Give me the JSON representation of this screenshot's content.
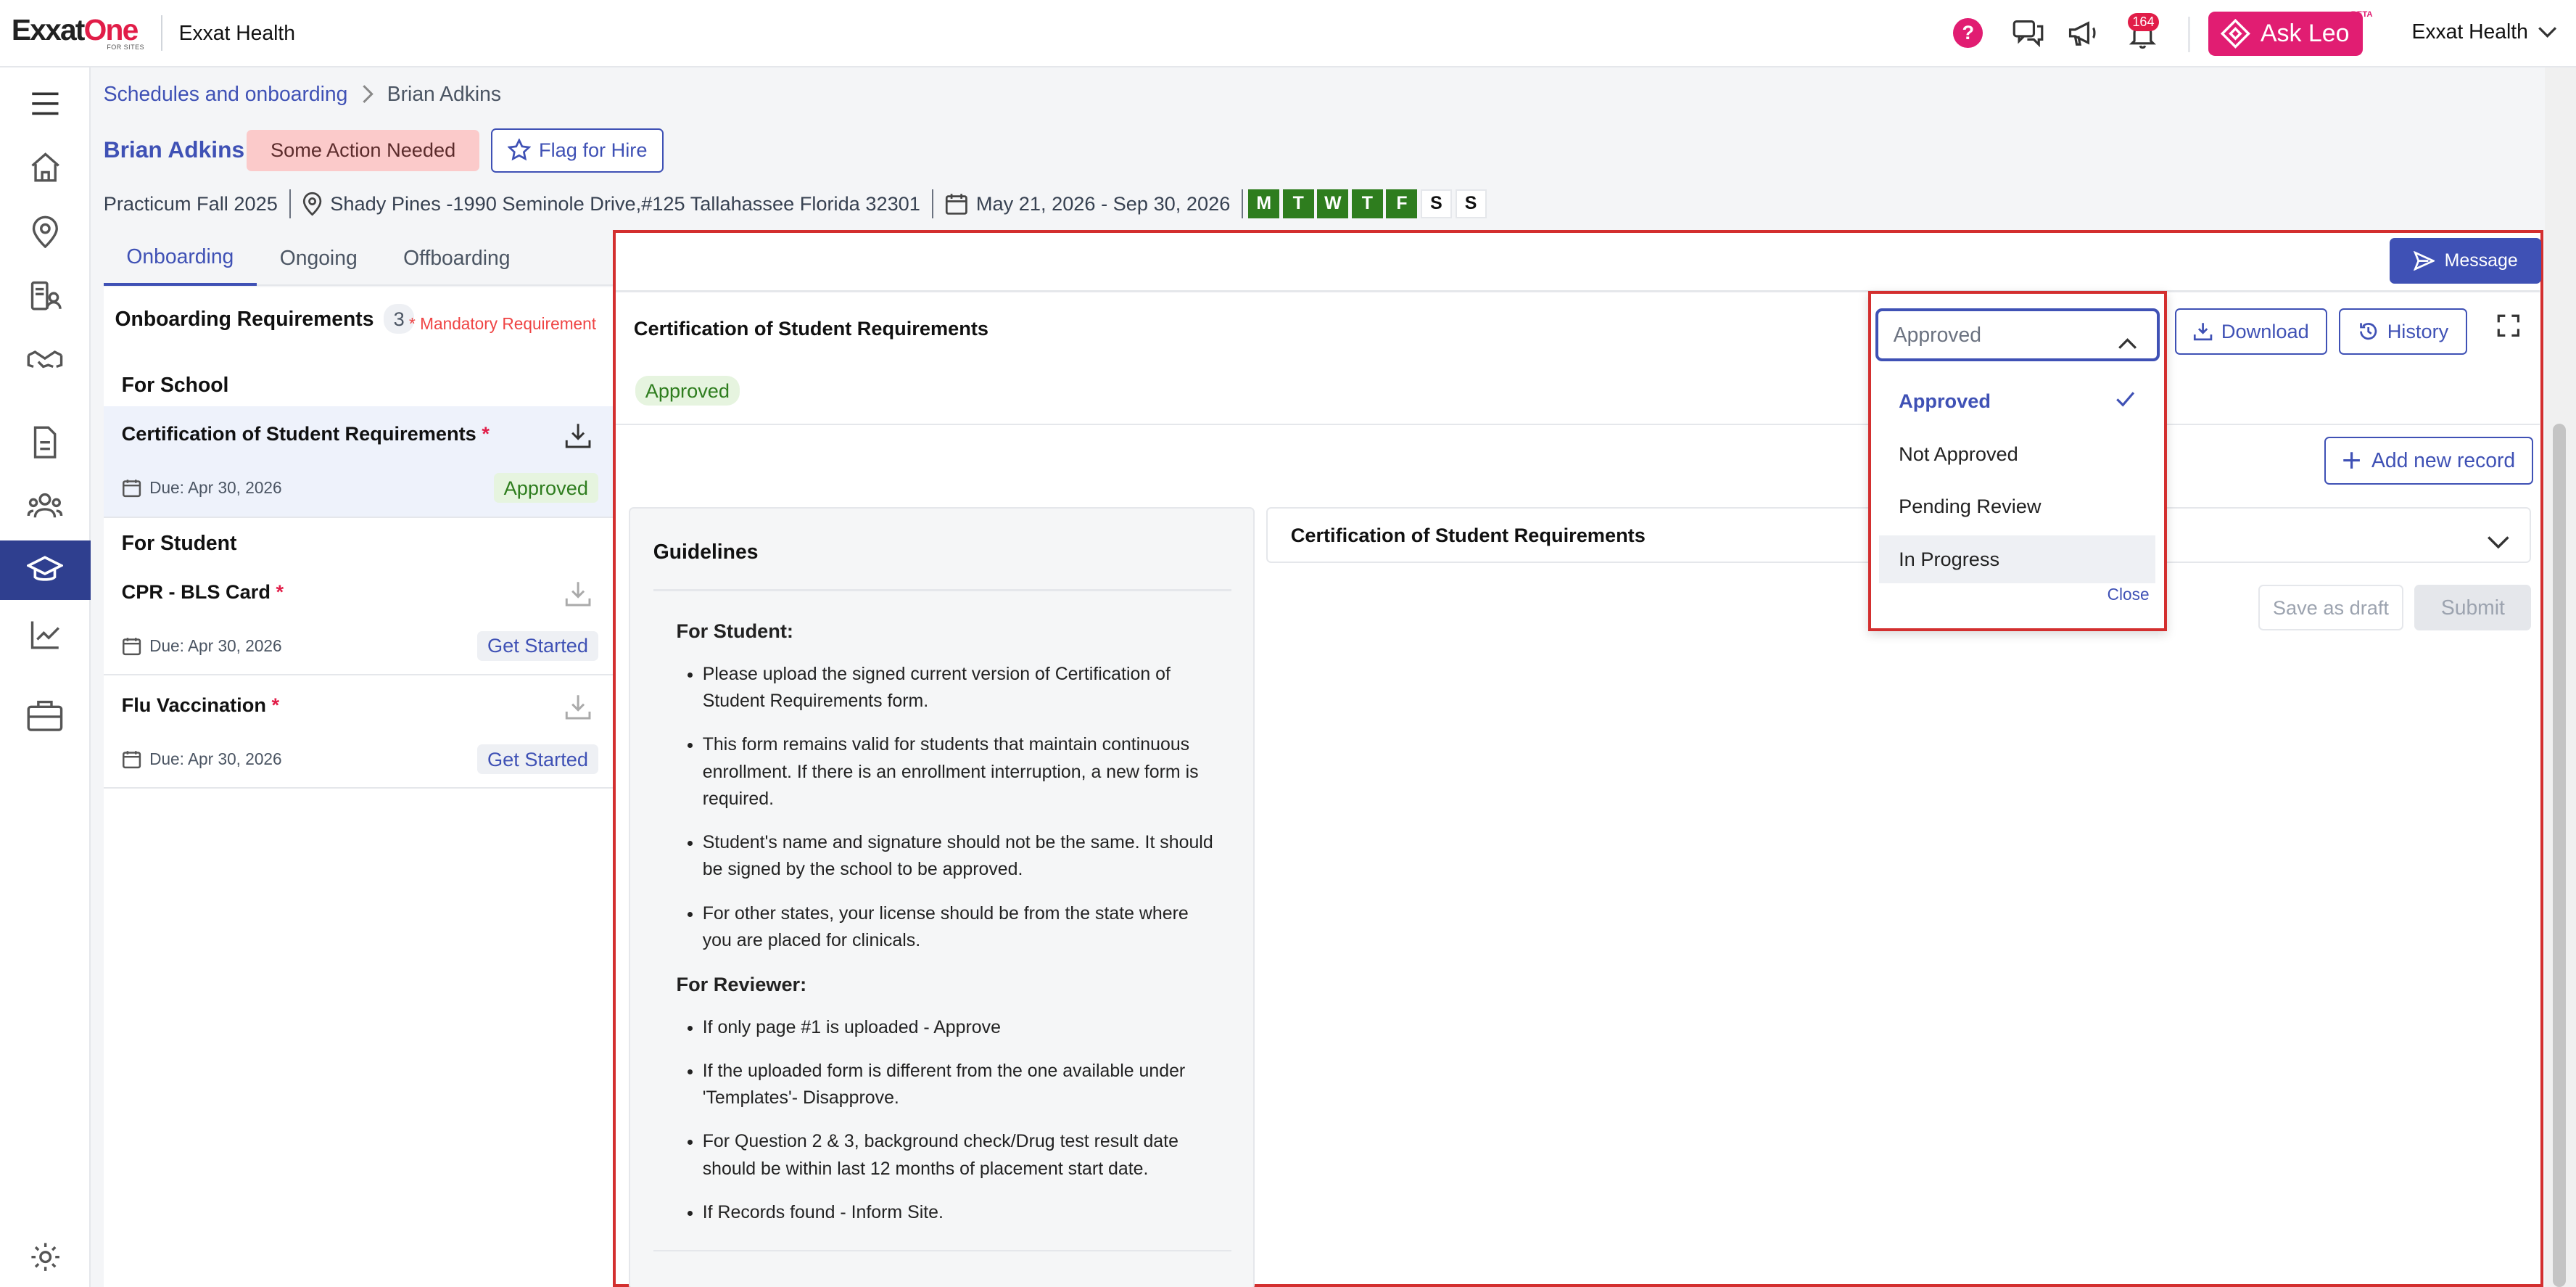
{
  "header": {
    "logo_main": "Exxat",
    "logo_one": "One",
    "logo_sub": "FOR SITES",
    "org_name": "Exxat Health",
    "help": "?",
    "notification_count": "164",
    "ask_leo": "Ask Leo",
    "beta": "BETA",
    "user_menu": "Exxat Health"
  },
  "breadcrumb": {
    "parent": "Schedules and onboarding",
    "current": "Brian Adkins"
  },
  "student": {
    "name": "Brian Adkins",
    "status_badge": "Some Action Needed",
    "flag_label": "Flag for Hire",
    "term": "Practicum Fall 2025",
    "site": "Shady Pines -1990 Seminole Drive,#125 Tallahassee Florida 32301",
    "dates": "May 21, 2026 - Sep 30, 2026",
    "days": [
      {
        "label": "M",
        "on": true
      },
      {
        "label": "T",
        "on": true
      },
      {
        "label": "W",
        "on": true
      },
      {
        "label": "T",
        "on": true
      },
      {
        "label": "F",
        "on": true
      },
      {
        "label": "S",
        "on": false
      },
      {
        "label": "S",
        "on": false
      }
    ]
  },
  "tabs": [
    "Onboarding",
    "Ongoing",
    "Offboarding"
  ],
  "requirements": {
    "heading": "Onboarding Requirements",
    "count": "3",
    "mandatory_note": "* Mandatory Requirement",
    "group_school": "For School",
    "group_student": "For Student",
    "items": [
      {
        "name": "Certification of Student Requirements",
        "star": "*",
        "due": "Due: Apr 30, 2026",
        "status": "Approved"
      },
      {
        "name": "CPR - BLS Card",
        "star": "*",
        "due": "Due: Apr 30, 2026",
        "status": "Get Started"
      },
      {
        "name": "Flu Vaccination",
        "star": "*",
        "due": "Due: Apr 30, 2026",
        "status": "Get Started"
      }
    ]
  },
  "detail": {
    "message_label": "Message",
    "title": "Certification of Student Requirements",
    "status": "Approved",
    "download_label": "Download",
    "history_label": "History",
    "add_record_label": "Add new record",
    "accordion_title": "Certification of Student Requirements",
    "save_draft_label": "Save as draft",
    "submit_label": "Submit"
  },
  "guidelines": {
    "title": "Guidelines",
    "student_heading": "For Student:",
    "student_items": [
      "Please upload the signed current version of Certification of Student Requirements form.",
      "This form remains valid for students that maintain continuous enrollment. If there is an enrollment interruption, a new form is required.",
      "Student's name and signature should not be the same. It should be signed by the school to be approved.",
      "For other states, your license should be from the state where you are placed for clinicals."
    ],
    "reviewer_heading": "For Reviewer:",
    "reviewer_items": [
      "If only page #1 is uploaded - Approve",
      "If the uploaded form is different from the one available under 'Templates'- Disapprove.",
      "For Question 2 & 3, background check/Drug test result date should be within last 12 months of placement start date.",
      "If Records found - Inform Site."
    ]
  },
  "status_dropdown": {
    "selected": "Approved",
    "options": [
      "Approved",
      "Not Approved",
      "Pending Review",
      "In Progress"
    ],
    "close_label": "Close"
  },
  "colors": {
    "primary": "#3f51b5",
    "brand_pink": "#e11d72",
    "approved_green": "#2e7d1e",
    "highlight_red": "#d32f2f"
  }
}
